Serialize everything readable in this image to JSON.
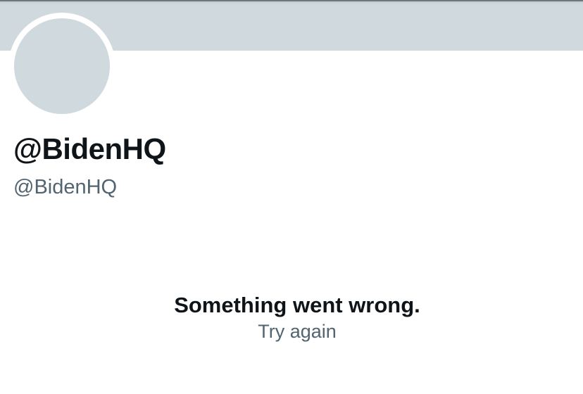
{
  "profile": {
    "display_name": "@BidenHQ",
    "handle": "@BidenHQ"
  },
  "error": {
    "title": "Something went wrong.",
    "retry_label": "Try again"
  },
  "colors": {
    "banner": "#cfd9de",
    "avatar_placeholder": "#cfd9de",
    "primary_text": "#0f1419",
    "secondary_text": "#536471"
  }
}
